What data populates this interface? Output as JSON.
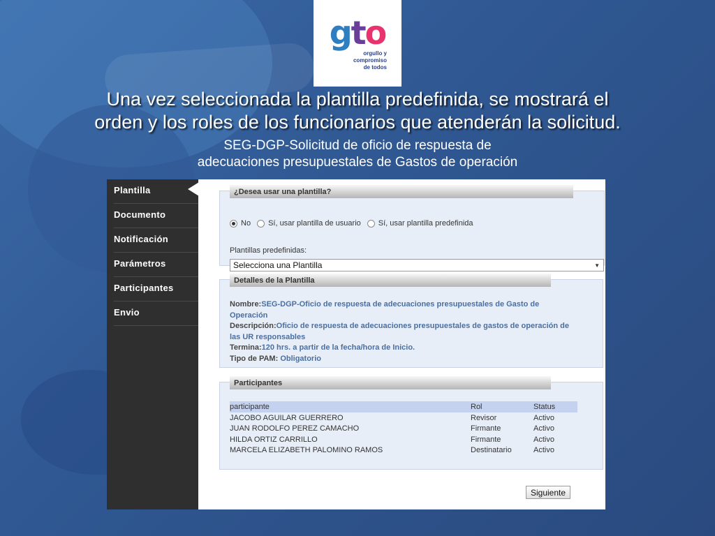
{
  "logo": {
    "wordmark": [
      "g",
      "t",
      "o"
    ],
    "tagline": [
      "orgullo y",
      "compromiso",
      "de todos"
    ],
    "colors": {
      "g": "#2d7fc1",
      "t": "#6a3f98",
      "o": "#e8336f"
    }
  },
  "slide": {
    "title_lines": [
      "Una vez seleccionada la plantilla predefinida, se mostrará el",
      "orden y los roles de los funcionarios que atenderán la solicitud."
    ],
    "subtitle_lines": [
      "SEG-DGP-Solicitud de oficio de respuesta de",
      "adecuaciones presupuestales de Gastos de operación"
    ]
  },
  "sidebar": {
    "items": [
      {
        "label": "Plantilla",
        "active": true
      },
      {
        "label": "Documento"
      },
      {
        "label": "Notificación"
      },
      {
        "label": "Parámetros"
      },
      {
        "label": "Participantes"
      },
      {
        "label": "Envio"
      }
    ]
  },
  "template_panel": {
    "header": "¿Desea usar una plantilla?",
    "radios": [
      {
        "label": "No",
        "checked": true
      },
      {
        "label": "Sí, usar plantilla de usuario"
      },
      {
        "label": "Sí, usar plantilla predefinida"
      }
    ],
    "predefined_label": "Plantillas predefinidas:",
    "select_value": "Selecciona una Plantilla"
  },
  "details_panel": {
    "header": "Detalles de la Plantilla",
    "nombre_label": "Nombre:",
    "nombre_value": "SEG-DGP-Oficio de respuesta de adecuaciones presupuestales de Gasto de Operación",
    "descripcion_label": "Descripción:",
    "descripcion_value": "Oficio de respuesta de adecuaciones presupuestales de gastos de operación de las UR responsables",
    "termina_label": "Termina:",
    "termina_value": "120 hrs. a partir de la fecha/hora de Inicio.",
    "tipo_label": "Tipo de PAM:",
    "tipo_value": "Obligatorio"
  },
  "participants_panel": {
    "header": "Participantes",
    "columns": [
      "participante",
      "Rol",
      "Status"
    ],
    "rows": [
      [
        "JACOBO AGUILAR GUERRERO",
        "Revisor",
        "Activo"
      ],
      [
        "JUAN RODOLFO PEREZ CAMACHO",
        "Firmante",
        "Activo"
      ],
      [
        "HILDA ORTIZ CARRILLO",
        "Firmante",
        "Activo"
      ],
      [
        "MARCELA ELIZABETH PALOMINO RAMOS",
        "Destinatario",
        "Activo"
      ]
    ]
  },
  "next_button": "Siguiente"
}
